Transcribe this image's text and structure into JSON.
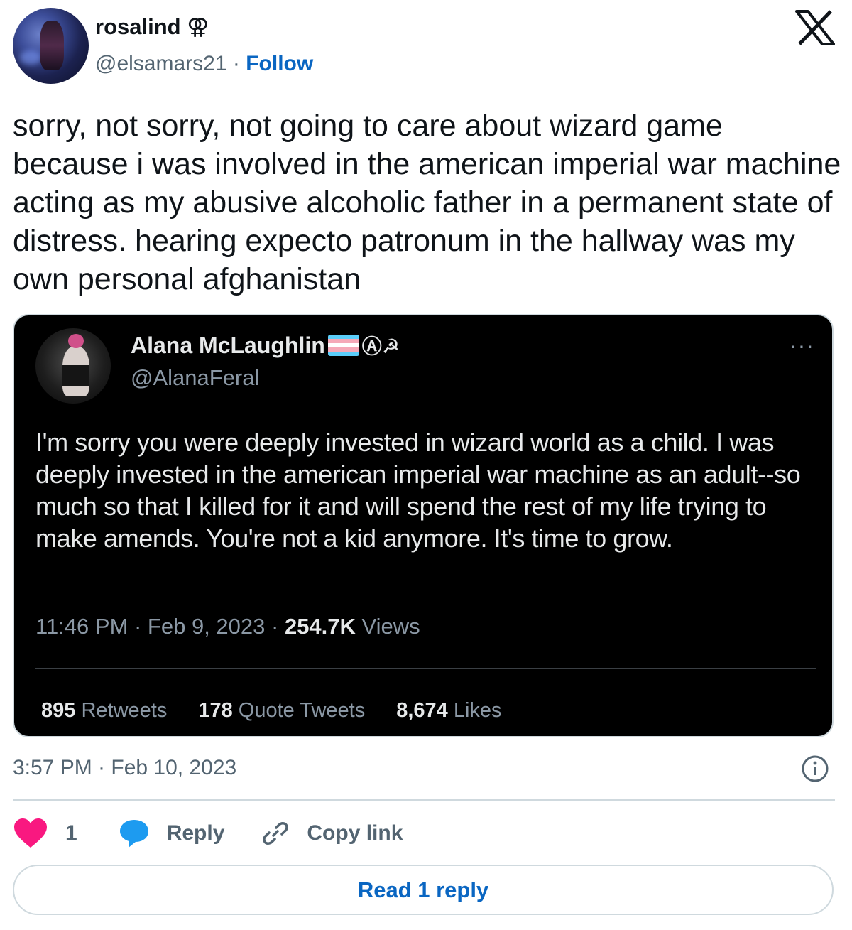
{
  "author": {
    "display_name": "rosalind",
    "display_name_symbol": "⚢",
    "handle": "@elsamars21",
    "separator": "·",
    "follow_label": "Follow"
  },
  "tweet": {
    "text": "sorry, not sorry, not going to care about wizard game because i was involved in the american imperial war machine acting as my abusive alcoholic father in a permanent state of distress. hearing expecto patronum in the hallway was my own personal afghanistan",
    "timestamp": "3:57 PM · Feb 10, 2023"
  },
  "quoted": {
    "display_name": "Alana McLaughlin",
    "name_symbols": "Ⓐ☭",
    "flag_colors": [
      "#5bcefa",
      "#f5a9b8",
      "#ffffff",
      "#f5a9b8",
      "#5bcefa"
    ],
    "handle": "@AlanaFeral",
    "more_label": "···",
    "text": "I'm sorry you were deeply invested in wizard world as a child. I was deeply invested in the american imperial war machine as an adult--so much so that I killed for it and will spend the rest of my life trying to make amends. You're not a kid anymore. It's time to grow.",
    "time": "11:46 PM · Feb 9, 2023 · ",
    "views_count": "254.7K",
    "views_label": " Views",
    "stats": {
      "retweets_count": "895",
      "retweets_label": " Retweets",
      "quotes_count": "178",
      "quotes_label": " Quote Tweets",
      "likes_count": "8,674",
      "likes_label": " Likes"
    }
  },
  "actions": {
    "like_count": "1",
    "reply_label": "Reply",
    "copy_label": "Copy link"
  },
  "read_replies_label": "Read 1 reply",
  "colors": {
    "accent": "#0a66c2",
    "like": "#f91880",
    "reply": "#1d9bf0"
  },
  "icons": [
    "x-logo-icon",
    "ellipsis-icon",
    "info-icon",
    "heart-icon",
    "reply-bubble-icon",
    "link-icon"
  ]
}
